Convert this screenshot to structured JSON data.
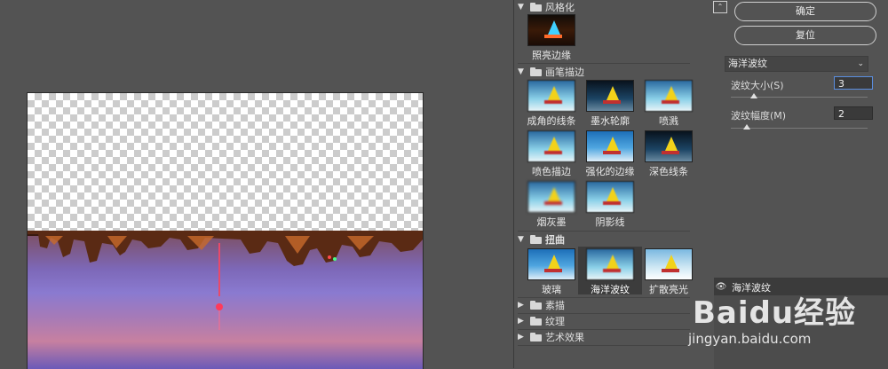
{
  "gallery": {
    "categories": [
      {
        "name": "风格化",
        "expanded": true,
        "filters": [
          {
            "label": "照亮边缘"
          }
        ]
      },
      {
        "name": "画笔描边",
        "expanded": true,
        "filters": [
          {
            "label": "成角的线条"
          },
          {
            "label": "墨水轮廓"
          },
          {
            "label": "喷溅"
          },
          {
            "label": "喷色描边"
          },
          {
            "label": "强化的边缘"
          },
          {
            "label": "深色线条"
          },
          {
            "label": "烟灰墨"
          },
          {
            "label": "阴影线"
          }
        ]
      },
      {
        "name": "扭曲",
        "expanded": true,
        "filters": [
          {
            "label": "玻璃"
          },
          {
            "label": "海洋波纹",
            "selected": true
          },
          {
            "label": "扩散亮光"
          }
        ]
      },
      {
        "name": "素描",
        "expanded": false
      },
      {
        "name": "纹理",
        "expanded": false
      },
      {
        "name": "艺术效果",
        "expanded": false
      }
    ]
  },
  "settings": {
    "ok_label": "确定",
    "reset_label": "复位",
    "filter_selected": "海洋波纹",
    "params": [
      {
        "label": "波纹大小(S)",
        "value": "3",
        "level_fraction": 0.15
      },
      {
        "label": "波纹幅度(M)",
        "value": "2",
        "level_fraction": 0.1
      }
    ],
    "effect_layer_name": "海洋波纹"
  },
  "watermark": {
    "brand": "Baidu经验",
    "url": "jingyan.baidu.com"
  }
}
